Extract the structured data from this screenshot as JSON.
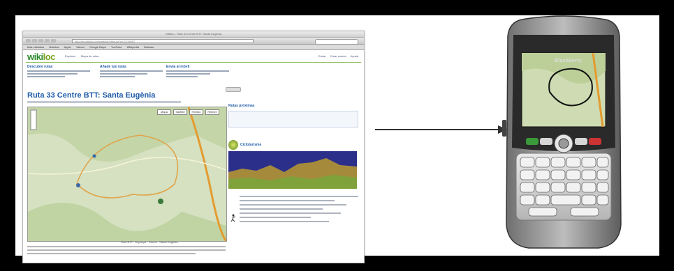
{
  "browser": {
    "window_title": "Wikiloc - Ruta 33 Centre BTT: Santa Eugènia",
    "url": "http://es.wikiloc.com/wikiloc/view.do?id=1234567",
    "bookmarks": [
      "Más visitados",
      "Noticias",
      "Apple",
      "Yahoo!",
      "Google Maps",
      "YouTube",
      "Wikipedia",
      "Noticias"
    ]
  },
  "site": {
    "logo_a": "wiki",
    "logo_b": "loc",
    "nav": [
      "Explorar",
      "Mapa de rutas"
    ],
    "topright": [
      "Entrar",
      "Crear cuenta",
      "Ayuda"
    ],
    "features": [
      "Descubre rutas",
      "Añade tus rutas",
      "Envía al móvil"
    ],
    "route_title": "Ruta 33 Centre BTT: Santa Eugènia",
    "map_buttons": [
      "Mapa",
      "Satélite",
      "Híbrido",
      "Relieve"
    ],
    "map_caption": "Ruta BTT · Espanya · Girona · Santa Eugènia",
    "sidebar_title": "Rutas próximas",
    "user_name": "Cicloturisme"
  },
  "phone": {
    "brand": "BlackBerry"
  },
  "colors": {
    "brand_green": "#2e8b2e",
    "link_blue": "#1d5aa8",
    "profile_bg": "#2c2f8a"
  }
}
